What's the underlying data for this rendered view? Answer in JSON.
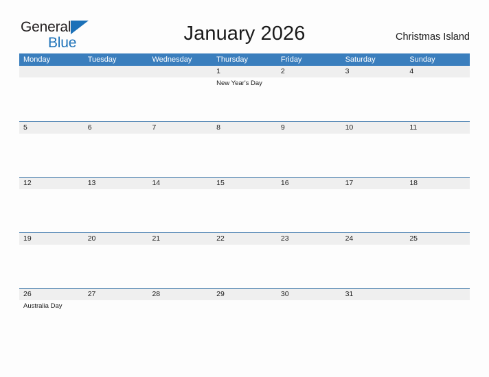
{
  "brand": {
    "name_part1": "General",
    "name_part2": "Blue",
    "flag_icon": "flag-triangle-icon",
    "accent_color": "#1c71b8"
  },
  "header": {
    "title": "January 2026",
    "location": "Christmas Island"
  },
  "colors": {
    "weekday_header_bg": "#3a7ebd",
    "week_row_border": "#2e6da4",
    "day_band_bg": "#efefef",
    "page_bg": "#fdfdfd",
    "text": "#1a1a1a"
  },
  "calendar": {
    "month": "January",
    "year": "2026",
    "first_day_of_week": "Monday",
    "weekdays": [
      "Monday",
      "Tuesday",
      "Wednesday",
      "Thursday",
      "Friday",
      "Saturday",
      "Sunday"
    ],
    "weeks": [
      {
        "days": [
          {
            "number": "",
            "events": []
          },
          {
            "number": "",
            "events": []
          },
          {
            "number": "",
            "events": []
          },
          {
            "number": "1",
            "events": [
              "New Year's Day"
            ]
          },
          {
            "number": "2",
            "events": []
          },
          {
            "number": "3",
            "events": []
          },
          {
            "number": "4",
            "events": []
          }
        ]
      },
      {
        "days": [
          {
            "number": "5",
            "events": []
          },
          {
            "number": "6",
            "events": []
          },
          {
            "number": "7",
            "events": []
          },
          {
            "number": "8",
            "events": []
          },
          {
            "number": "9",
            "events": []
          },
          {
            "number": "10",
            "events": []
          },
          {
            "number": "11",
            "events": []
          }
        ]
      },
      {
        "days": [
          {
            "number": "12",
            "events": []
          },
          {
            "number": "13",
            "events": []
          },
          {
            "number": "14",
            "events": []
          },
          {
            "number": "15",
            "events": []
          },
          {
            "number": "16",
            "events": []
          },
          {
            "number": "17",
            "events": []
          },
          {
            "number": "18",
            "events": []
          }
        ]
      },
      {
        "days": [
          {
            "number": "19",
            "events": []
          },
          {
            "number": "20",
            "events": []
          },
          {
            "number": "21",
            "events": []
          },
          {
            "number": "22",
            "events": []
          },
          {
            "number": "23",
            "events": []
          },
          {
            "number": "24",
            "events": []
          },
          {
            "number": "25",
            "events": []
          }
        ]
      },
      {
        "days": [
          {
            "number": "26",
            "events": [
              "Australia Day"
            ]
          },
          {
            "number": "27",
            "events": []
          },
          {
            "number": "28",
            "events": []
          },
          {
            "number": "29",
            "events": []
          },
          {
            "number": "30",
            "events": []
          },
          {
            "number": "31",
            "events": []
          },
          {
            "number": "",
            "events": []
          }
        ]
      }
    ]
  }
}
